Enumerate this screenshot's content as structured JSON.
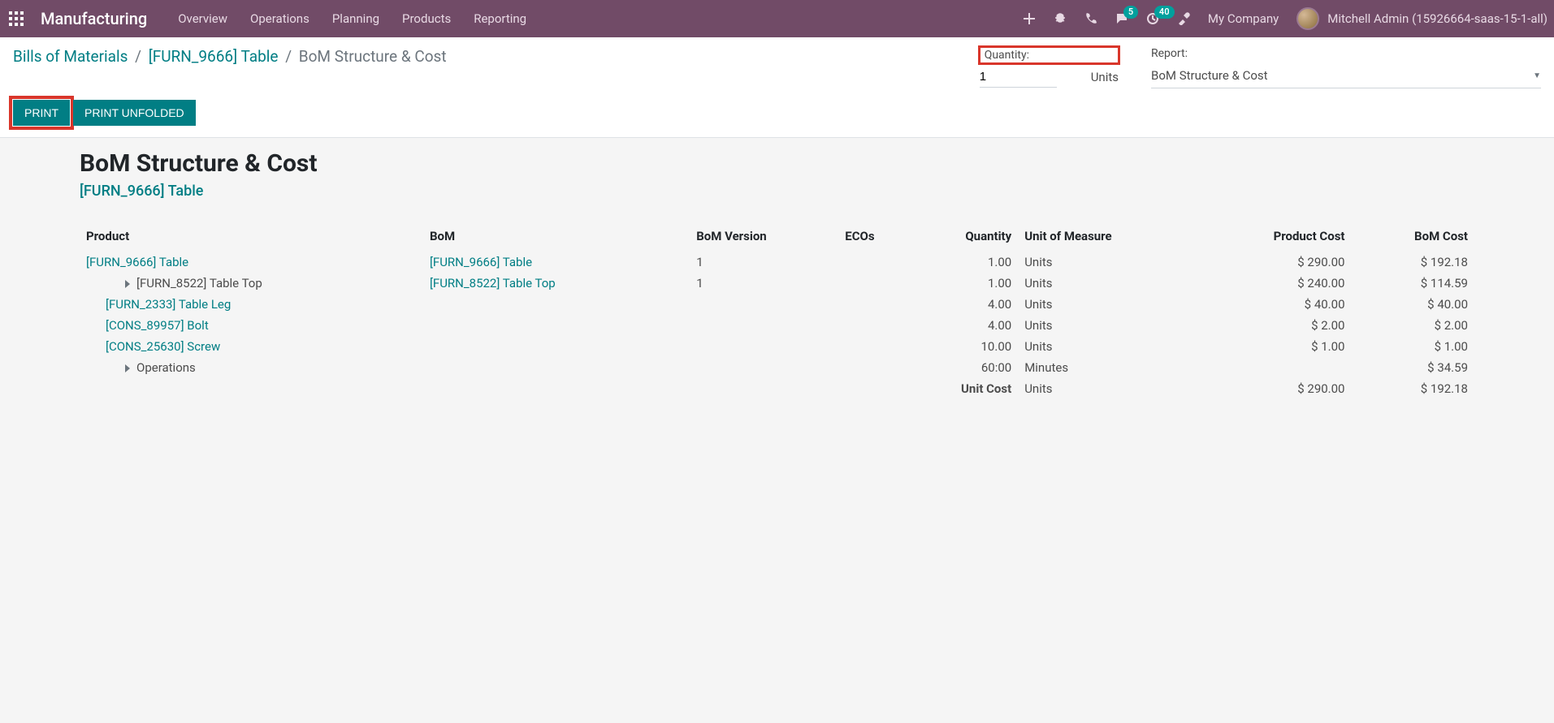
{
  "navbar": {
    "brand": "Manufacturing",
    "menu": [
      "Overview",
      "Operations",
      "Planning",
      "Products",
      "Reporting"
    ],
    "badges": {
      "chat": "5",
      "activity": "40"
    },
    "company": "My Company",
    "user": "Mitchell Admin (15926664-saas-15-1-all)"
  },
  "breadcrumb": {
    "root": "Bills of Materials",
    "item": "[FURN_9666] Table",
    "current": "BoM Structure & Cost"
  },
  "controls": {
    "quantity_label": "Quantity:",
    "quantity_value": "1",
    "units_label": "Units",
    "report_label": "Report:",
    "report_selected": "BoM Structure & Cost",
    "print": "PRINT",
    "print_unfolded": "PRINT UNFOLDED"
  },
  "report": {
    "title": "BoM Structure & Cost",
    "subtitle": "[FURN_9666] Table"
  },
  "columns": {
    "product": "Product",
    "bom": "BoM",
    "version": "BoM Version",
    "ecos": "ECOs",
    "qty": "Quantity",
    "uom": "Unit of Measure",
    "product_cost": "Product Cost",
    "bom_cost": "BoM Cost"
  },
  "rows": [
    {
      "indent": 0,
      "caret": false,
      "product": "[FURN_9666] Table",
      "link": true,
      "bom": "[FURN_9666] Table",
      "bom_link": true,
      "version": "1",
      "ecos": "",
      "qty": "1.00",
      "uom": "Units",
      "product_cost": "$ 290.00",
      "bom_cost": "$ 192.18"
    },
    {
      "indent": 2,
      "caret": true,
      "product": "[FURN_8522] Table Top",
      "link": false,
      "bom": "[FURN_8522] Table Top",
      "bom_link": true,
      "version": "1",
      "ecos": "",
      "qty": "1.00",
      "uom": "Units",
      "product_cost": "$ 240.00",
      "bom_cost": "$ 114.59"
    },
    {
      "indent": 1,
      "caret": false,
      "product": "[FURN_2333] Table Leg",
      "link": true,
      "bom": "",
      "bom_link": false,
      "version": "",
      "ecos": "",
      "qty": "4.00",
      "uom": "Units",
      "product_cost": "$ 40.00",
      "bom_cost": "$ 40.00"
    },
    {
      "indent": 1,
      "caret": false,
      "product": "[CONS_89957] Bolt",
      "link": true,
      "bom": "",
      "bom_link": false,
      "version": "",
      "ecos": "",
      "qty": "4.00",
      "uom": "Units",
      "product_cost": "$ 2.00",
      "bom_cost": "$ 2.00"
    },
    {
      "indent": 1,
      "caret": false,
      "product": "[CONS_25630] Screw",
      "link": true,
      "bom": "",
      "bom_link": false,
      "version": "",
      "ecos": "",
      "qty": "10.00",
      "uom": "Units",
      "product_cost": "$ 1.00",
      "bom_cost": "$ 1.00"
    },
    {
      "indent": 2,
      "caret": true,
      "product": "Operations",
      "link": false,
      "bom": "",
      "bom_link": false,
      "version": "",
      "ecos": "",
      "qty": "60:00",
      "uom": "Minutes",
      "product_cost": "",
      "bom_cost": "$ 34.59"
    }
  ],
  "total": {
    "label": "Unit Cost",
    "uom": "Units",
    "product_cost": "$ 290.00",
    "bom_cost": "$ 192.18"
  }
}
